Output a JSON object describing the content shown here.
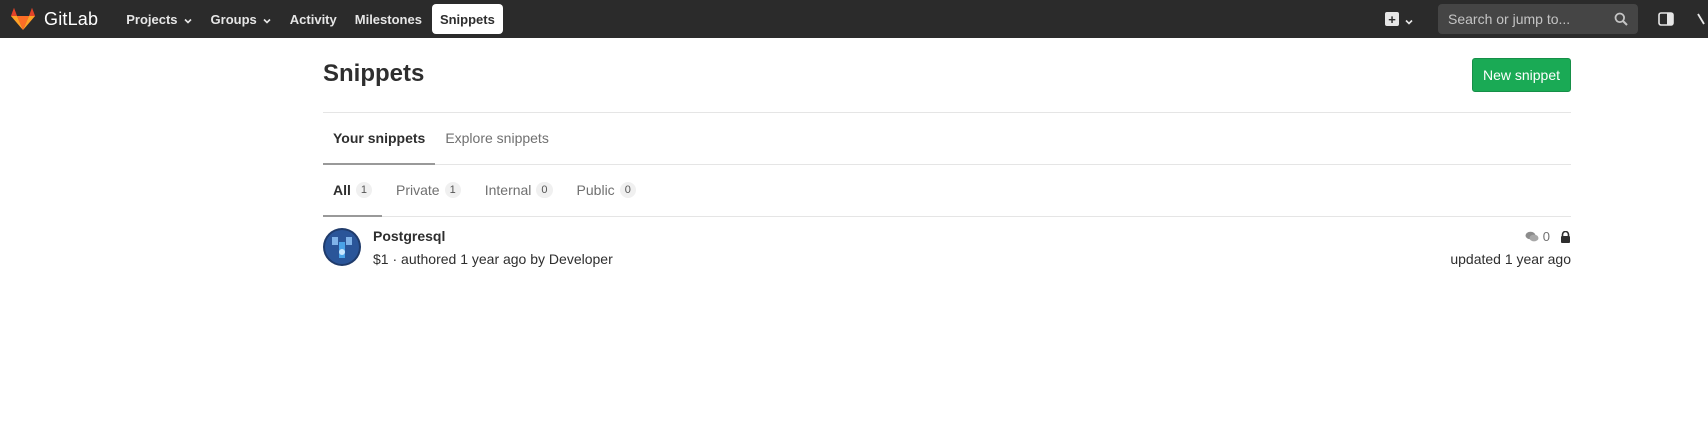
{
  "navbar": {
    "brand": "GitLab",
    "items": [
      {
        "label": "Projects",
        "dropdown": true
      },
      {
        "label": "Groups",
        "dropdown": true
      },
      {
        "label": "Activity",
        "dropdown": false
      },
      {
        "label": "Milestones",
        "dropdown": false
      },
      {
        "label": "Snippets",
        "dropdown": false,
        "active": true
      }
    ],
    "search_placeholder": "Search or jump to...",
    "icons": [
      "gitlab-logo-icon",
      "plus-square-icon",
      "chevron-down-icon",
      "search-icon",
      "sidebar-toggle-icon"
    ],
    "colors": {
      "navbar_bg": "#2b2b2b",
      "search_bg": "#454545"
    }
  },
  "page": {
    "title": "Snippets",
    "new_button": "New snippet",
    "colors": {
      "primary_button": "#1aaa55"
    }
  },
  "tabs": [
    {
      "label": "Your snippets",
      "active": true
    },
    {
      "label": "Explore snippets",
      "active": false
    }
  ],
  "scopes": [
    {
      "label": "All",
      "count": "1",
      "active": true
    },
    {
      "label": "Private",
      "count": "1",
      "active": false
    },
    {
      "label": "Internal",
      "count": "0",
      "active": false
    },
    {
      "label": "Public",
      "count": "0",
      "active": false
    }
  ],
  "snippets": [
    {
      "title": "Postgresql",
      "id": "$1",
      "authored": "authored 1 year ago",
      "by": "by Developer",
      "comments": "0",
      "updated": "updated 1 year ago",
      "visibility_icon": "lock-icon"
    }
  ]
}
